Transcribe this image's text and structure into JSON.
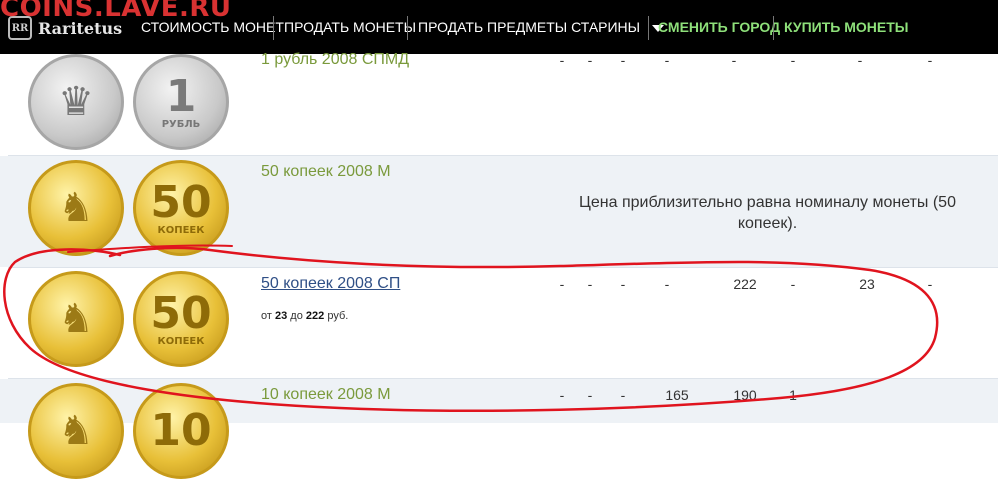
{
  "watermark": "COINS.LAVE.RU",
  "logo": {
    "badge": "RR",
    "text": "Raritetus"
  },
  "nav": {
    "items": [
      {
        "label": "СТОИМОСТЬ МОНЕТ"
      },
      {
        "label": "ПРОДАТЬ МОНЕТЫ"
      },
      {
        "label": "ПРОДАТЬ ПРЕДМЕТЫ СТАРИНЫ"
      },
      {
        "label": "СМЕНИТЬ ГОРОД"
      },
      {
        "label": "КУПИТЬ МОНЕТЫ"
      }
    ]
  },
  "coins": [
    {
      "title": "1 рубль 2008 СПМД",
      "obverse": "eagle",
      "reverse_big": "1",
      "reverse_small": "РУБЛЬ",
      "prices": [
        "-",
        "-",
        "-",
        "-",
        "-",
        "-",
        "-",
        "-"
      ]
    },
    {
      "title": "50 копеек 2008 М",
      "obverse": "george",
      "reverse_big": "50",
      "reverse_small": "КОПЕЕК",
      "note": "Цена приблизительно равна номиналу монеты (50 копеек)."
    },
    {
      "title": "50 копеек 2008 СП",
      "obverse": "george",
      "reverse_big": "50",
      "reverse_small": "КОПЕЕК",
      "price_from_label": "от",
      "price_from": "23",
      "price_to_label": "до",
      "price_to": "222",
      "price_unit": "руб.",
      "prices": [
        "-",
        "-",
        "-",
        "-",
        "222",
        "-",
        "23",
        "-"
      ]
    },
    {
      "title": "10 копеек 2008 М",
      "obverse": "george",
      "reverse_big": "10",
      "reverse_small": "",
      "prices": [
        "-",
        "-",
        "-",
        "165",
        "190",
        "1",
        "",
        ""
      ]
    }
  ],
  "colors": {
    "navbar": "#000000",
    "nav_green": "#8ee07a",
    "title_green": "#7a9a3c",
    "link_blue": "#2f4f86",
    "annotation_red": "#e0141e",
    "row_alt": "#eef2f6"
  }
}
